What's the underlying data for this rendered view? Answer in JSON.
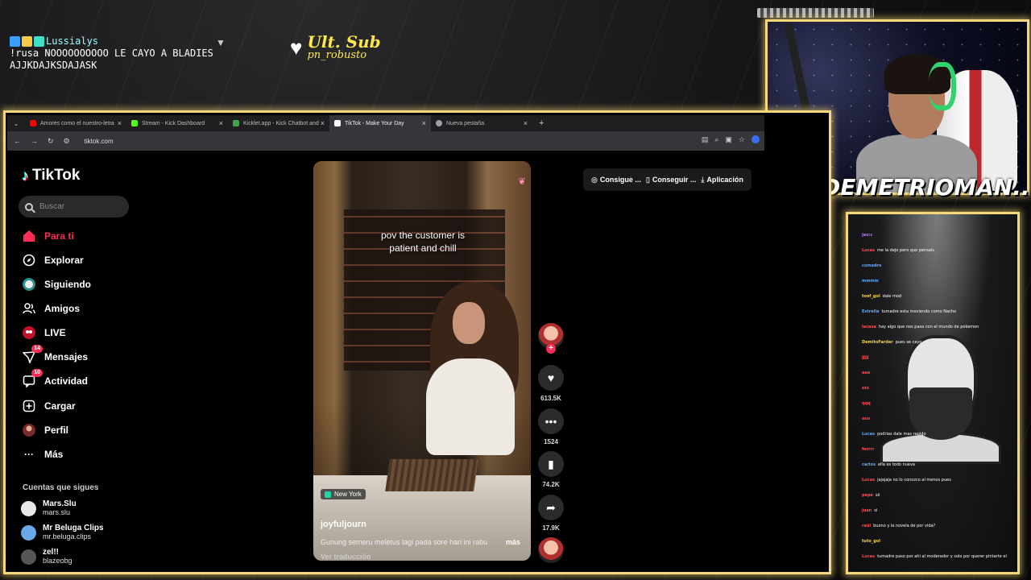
{
  "overlay_chat": {
    "username": "Lussialys",
    "message": "!rusa NOOOOOOOOOO LE CAYO A BLADIES AJJKDAJKSDAJASK"
  },
  "ult_sub": {
    "title": "Ult. Sub",
    "user": "pn_robusto"
  },
  "browser": {
    "tabs": [
      {
        "label": "Amores como el nuestro-letra",
        "color": "#ff0000"
      },
      {
        "label": "Stream - Kick Dashboard",
        "color": "#53fc18"
      },
      {
        "label": "Kicklet.app - Kick Chatbot and",
        "color": "#3fa34d"
      },
      {
        "label": "TikTok - Make Your Day",
        "color": "#ffffff"
      },
      {
        "label": "Nueva pestaña",
        "color": "#9aa0a6"
      }
    ],
    "url": "tiktok.com"
  },
  "tiktok": {
    "logo": "TikTok",
    "search_placeholder": "Buscar",
    "nav": [
      {
        "label": "Para ti",
        "icon": "home-icon"
      },
      {
        "label": "Explorar",
        "icon": "compass-icon"
      },
      {
        "label": "Siguiendo",
        "icon": "following-icon"
      },
      {
        "label": "Amigos",
        "icon": "friends-icon"
      },
      {
        "label": "LIVE",
        "icon": "live-icon"
      },
      {
        "label": "Mensajes",
        "icon": "messages-icon",
        "badge": "14"
      },
      {
        "label": "Actividad",
        "icon": "activity-icon",
        "badge": "10"
      },
      {
        "label": "Cargar",
        "icon": "upload-icon"
      },
      {
        "label": "Perfil",
        "icon": "profile-icon"
      },
      {
        "label": "Más",
        "icon": "more-icon"
      }
    ],
    "following_title": "Cuentas que sigues",
    "following": [
      {
        "name": "Mars.Slu",
        "handle": "mars.slu"
      },
      {
        "name": "Mr Beluga Clips",
        "handle": "mr.beluga.clips"
      },
      {
        "name": "zel!!",
        "handle": "blazeobg"
      }
    ],
    "top_actions": [
      "Consigue ...",
      "Conseguir ...",
      "Aplicación"
    ],
    "video": {
      "caption": "pov the customer is patient and chill",
      "location": "New York",
      "author": "joyfuljourn",
      "description": "Gunung semeru meletus lagi pada sore hari ini rabu",
      "more": "más",
      "translate": "Ver traducción"
    },
    "actions": {
      "likes": "613.5K",
      "comments": "1524",
      "saves": "74.2K",
      "shares": "17.9K"
    }
  },
  "streamer_name": "DEMETRIOMAN....",
  "side_chat": [
    {
      "user": "jeo:c",
      "msg": "",
      "color": "#b678ff"
    },
    {
      "user": "Lucas",
      "msg": "me la dejo pero que pensais",
      "color": "#ff4d4d"
    },
    {
      "user": "comadre",
      "msg": "",
      "color": "#5aa9ff"
    },
    {
      "user": "mmmm",
      "msg": "",
      "color": "#5aa9ff"
    },
    {
      "user": "toof_gol",
      "msg": "dale mod",
      "color": "#ffd23f"
    },
    {
      "user": "Estrella",
      "msg": "tumadre esta moviendo como Nacho",
      "color": "#5aa9ff"
    },
    {
      "user": "lacasa",
      "msg": "hay algo que nos pasa con el mundo de pokemon",
      "color": "#ff4d4d"
    },
    {
      "user": "DemitoFarder",
      "msg": "pues se cayo",
      "color": "#ffd23f"
    },
    {
      "user": "jjjjj",
      "msg": "",
      "color": "#ff4d4d"
    },
    {
      "user": "aaa",
      "msg": "",
      "color": "#ff4d4d"
    },
    {
      "user": "zzz",
      "msg": "",
      "color": "#ff4d4d"
    },
    {
      "user": "qqq",
      "msg": "",
      "color": "#ff4d4d"
    },
    {
      "user": "ooo",
      "msg": "",
      "color": "#ff4d4d"
    },
    {
      "user": "Lucas",
      "msg": "podrias dale mas rapido",
      "color": "#5aa9ff"
    },
    {
      "user": "ferrrr",
      "msg": "",
      "color": "#ff4d4d"
    },
    {
      "user": "carlos",
      "msg": "ella es todo nueva",
      "color": "#5aa9ff"
    },
    {
      "user": "Lucas",
      "msg": "jajajaja no lo conozco al menos pues",
      "color": "#ff4d4d"
    },
    {
      "user": "pepe",
      "msg": "sii",
      "color": "#ff4d4d"
    },
    {
      "user": "juan",
      "msg": "si",
      "color": "#ff4d4d"
    },
    {
      "user": "raul",
      "msg": "bueno y la novela de por vida?",
      "color": "#ff4d4d"
    },
    {
      "user": "tuto_gol",
      "msg": "",
      "color": "#ffd23f"
    },
    {
      "user": "Lucas",
      "msg": "tumadre paso por ahi al moderador y solo por querer pintarte el",
      "color": "#ff4d4d"
    }
  ]
}
